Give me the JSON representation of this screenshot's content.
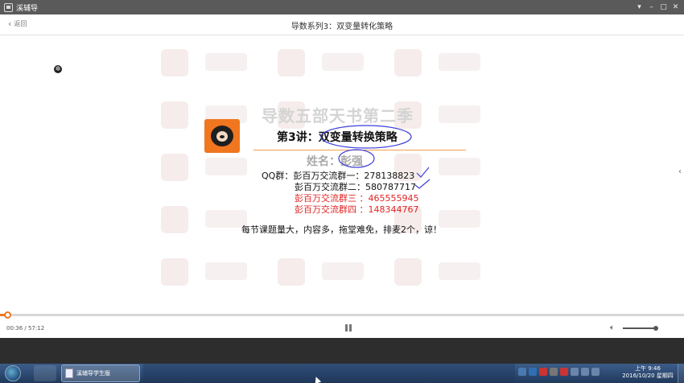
{
  "window": {
    "app_title": "溪辅导",
    "controls": [
      "minimize-icon",
      "maximize-icon",
      "close-icon"
    ]
  },
  "header": {
    "back_label": "返回",
    "lesson_title": "导数系列3：双变量转化策略"
  },
  "slide": {
    "series_title": "导数五部天书第二季",
    "lecture_title": "第3讲：双变量转换策略",
    "teacher_line": "姓名：彭强",
    "qq_groups": [
      "QQ群：彭百万交流群一：278138823",
      "彭百万交流群二：580787717",
      "彭百万交流群三 ：465555945",
      "彭百万交流群四 ：148344767"
    ],
    "notice": "每节课题量大，内容多，拖堂难免，排麦2个，谅！"
  },
  "player": {
    "time": "00:36 / 57:12",
    "progress_fraction": 0.0105,
    "volume_fraction": 0.98,
    "accent": "#f0761f"
  },
  "taskbar": {
    "task_label": "溪辅导学生版",
    "clock_time": "上午 9:46",
    "clock_date": "2016/10/20 星期四"
  },
  "colors": {
    "accent_orange": "#f0761f",
    "red_text": "#e02424",
    "annotation_blue": "#3b3fd8"
  }
}
